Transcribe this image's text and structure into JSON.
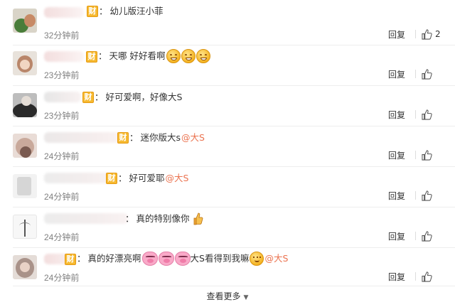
{
  "comments": [
    {
      "text": "幼儿版汪小菲",
      "mentions": [],
      "emojis": [],
      "time": "32分钟前",
      "reply_label": "回复",
      "like_count": "2"
    },
    {
      "text": "天哪 好好看啊",
      "mentions": [],
      "emojis": [
        "grin",
        "grin",
        "grin"
      ],
      "time": "23分钟前",
      "reply_label": "回复",
      "like_count": ""
    },
    {
      "text": "好可爱啊，好像大S",
      "mentions": [],
      "emojis": [],
      "time": "23分钟前",
      "reply_label": "回复",
      "like_count": ""
    },
    {
      "text": "迷你版大s",
      "mentions": [
        "@大S"
      ],
      "emojis": [],
      "time": "24分钟前",
      "reply_label": "回复",
      "like_count": ""
    },
    {
      "text": "好可爱耶",
      "mentions": [
        "@大S"
      ],
      "emojis": [],
      "time": "24分钟前",
      "reply_label": "回复",
      "like_count": ""
    },
    {
      "text": "真的特别像你",
      "mentions": [],
      "emojis": [
        "thumbs-up"
      ],
      "time": "24分钟前",
      "reply_label": "回复",
      "like_count": ""
    },
    {
      "text": "真的好漂亮啊",
      "text2": "大S看得到我嘛",
      "mentions": [
        "@大S"
      ],
      "emojis": [
        "pig",
        "pig",
        "pig",
        "smile"
      ],
      "time": "24分钟前",
      "reply_label": "回复",
      "like_count": ""
    }
  ],
  "badge_char": "财",
  "colon": "：",
  "more_label": "查看更多",
  "icons": {
    "like": "thumbs-up-icon",
    "more": "chevron-down-icon"
  },
  "colors": {
    "mention": "#eb7350",
    "time": "#808080",
    "badge": "#f6b930",
    "divider": "#eeeeee"
  }
}
